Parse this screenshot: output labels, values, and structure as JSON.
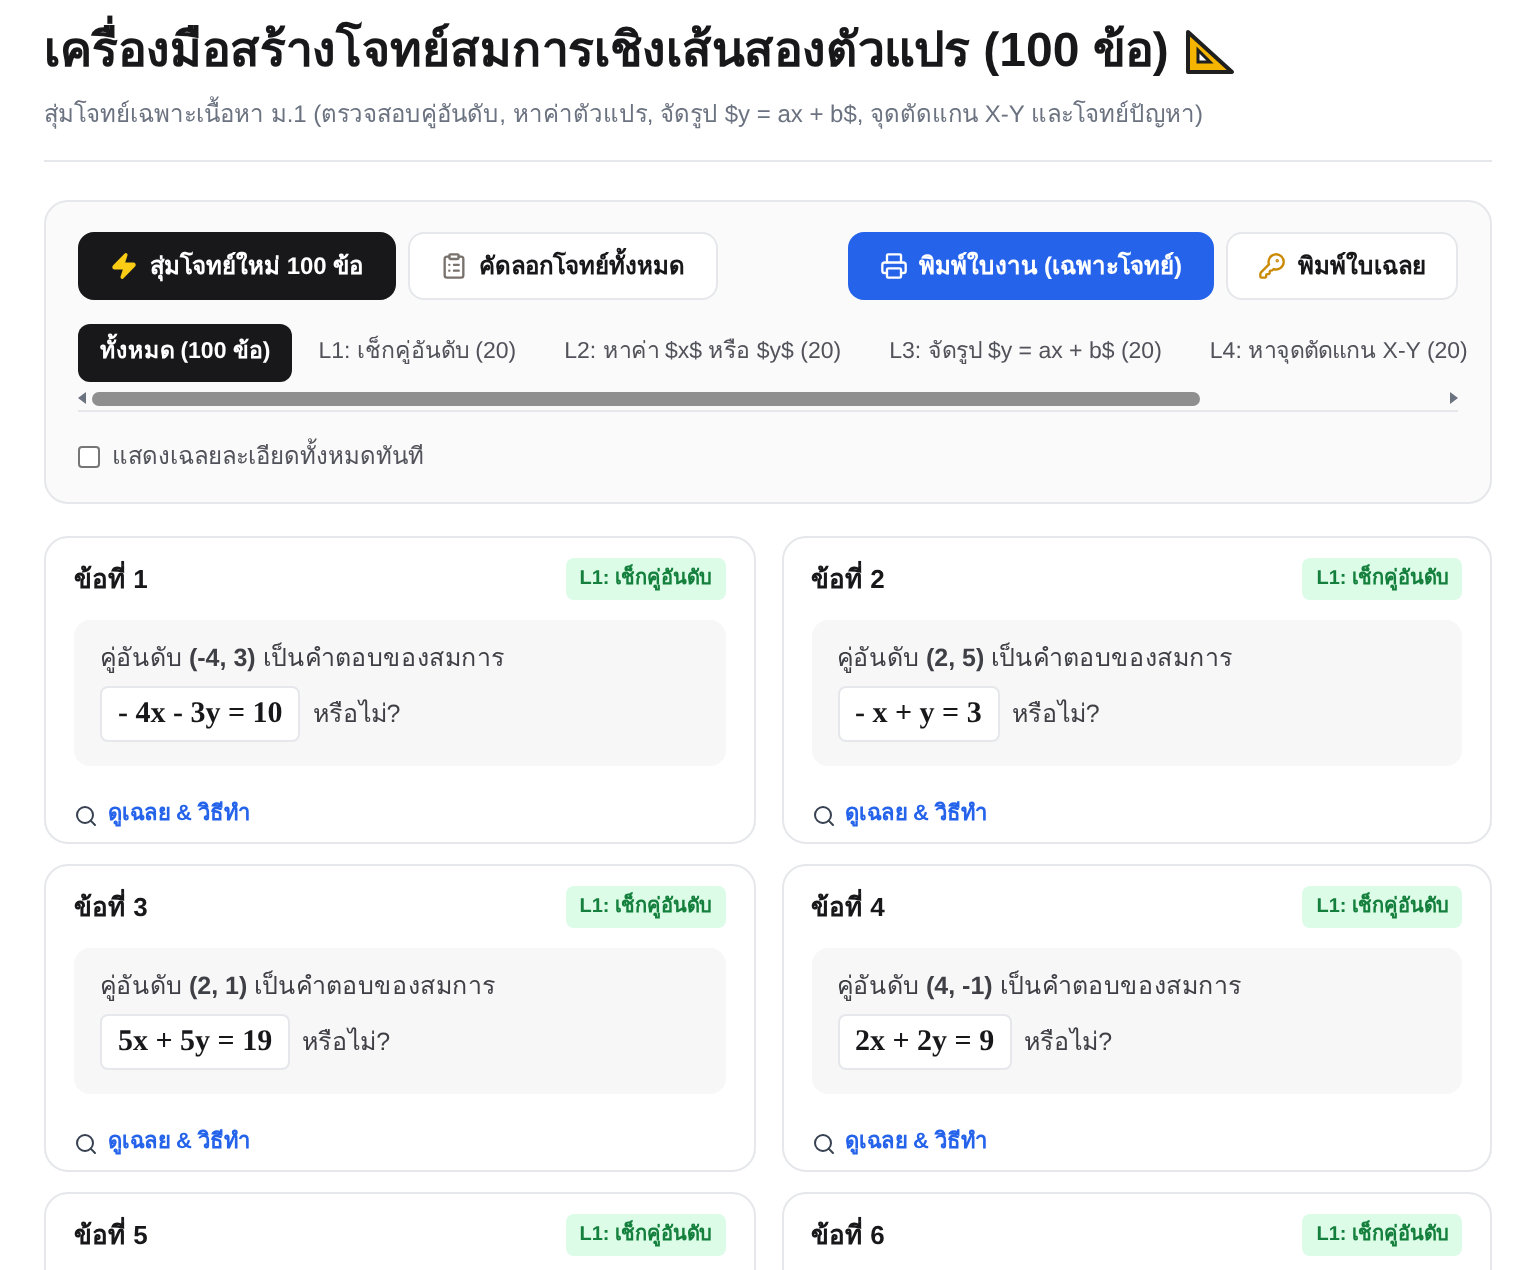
{
  "header": {
    "title": "เครื่องมือสร้างโจทย์สมการเชิงเส้นสองตัวแปร (100 ข้อ)",
    "subtitle": "สุ่มโจทย์เฉพาะเนื้อหา ม.1 (ตรวจสอบคู่อันดับ, หาค่าตัวแปร, จัดรูป $y = ax + b$, จุดตัดแกน X-Y และโจทย์ปัญหา)"
  },
  "toolbar": {
    "buttons": [
      {
        "label": "สุ่มโจทย์ใหม่ 100 ข้อ",
        "kind": "dark"
      },
      {
        "label": "คัดลอกโจทย์ทั้งหมด",
        "kind": "outline"
      },
      {
        "label": "พิมพ์ใบงาน (เฉพาะโจทย์)",
        "kind": "primary"
      },
      {
        "label": "พิมพ์ใบเฉลย",
        "kind": "outline"
      }
    ]
  },
  "tabs": [
    {
      "label": "ทั้งหมด (100 ข้อ)",
      "selected": true
    },
    {
      "label": "L1: เช็กคู่อันดับ (20)",
      "selected": false
    },
    {
      "label": "L2: หาค่า $x$ หรือ $y$ (20)",
      "selected": false
    },
    {
      "label": "L3: จัดรูป $y = ax + b$ (20)",
      "selected": false
    },
    {
      "label": "L4: หาจุดตัดแกน X-Y (20)",
      "selected": false
    }
  ],
  "show_all_answers": {
    "label": "แสดงเฉลยละเอียดทั้งหมดทันที",
    "checked": false
  },
  "questions": [
    {
      "title": "ข้อที่ 1",
      "tag": "L1: เช็กคู่อันดับ",
      "statement": "คู่อันดับ **(-4, 3)** เป็นคำตอบของสมการ",
      "equation": "- 4x - 3y = 10",
      "suffix": "หรือไม่?",
      "link": "ดูเฉลย & วิธีทำ"
    },
    {
      "title": "ข้อที่ 2",
      "tag": "L1: เช็กคู่อันดับ",
      "statement": "คู่อันดับ **(2, 5)** เป็นคำตอบของสมการ",
      "equation": "- x + y = 3",
      "suffix": "หรือไม่?",
      "link": "ดูเฉลย & วิธีทำ"
    },
    {
      "title": "ข้อที่ 3",
      "tag": "L1: เช็กคู่อันดับ",
      "statement": "คู่อันดับ **(2, 1)** เป็นคำตอบของสมการ",
      "equation": "5x + 5y = 19",
      "suffix": "หรือไม่?",
      "link": "ดูเฉลย & วิธีทำ"
    },
    {
      "title": "ข้อที่ 4",
      "tag": "L1: เช็กคู่อันดับ",
      "statement": "คู่อันดับ **(4, -1)** เป็นคำตอบของสมการ",
      "equation": "2x + 2y = 9",
      "suffix": "หรือไม่?",
      "link": "ดูเฉลย & วิธีทำ"
    },
    {
      "title": "ข้อที่ 5",
      "tag": "L1: เช็กคู่อันดับ"
    },
    {
      "title": "ข้อที่ 6",
      "tag": "L1: เช็กคู่อันดับ"
    }
  ]
}
